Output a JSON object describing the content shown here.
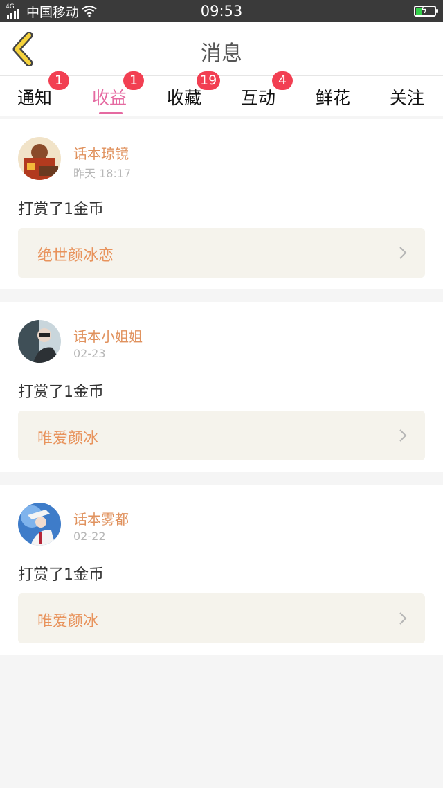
{
  "status_bar": {
    "network": "4G",
    "carrier": "中国移动",
    "time": "09:53"
  },
  "header": {
    "title": "消息",
    "back_icon": "chevron-left-icon"
  },
  "tabs": [
    {
      "label": "通知",
      "badge": "1"
    },
    {
      "label": "收益",
      "badge": "1",
      "active": true
    },
    {
      "label": "收藏",
      "badge": "19"
    },
    {
      "label": "互动",
      "badge": "4"
    },
    {
      "label": "鲜花",
      "badge": ""
    },
    {
      "label": "关注",
      "badge": ""
    }
  ],
  "messages": [
    {
      "user": "话本琼镜",
      "time": "昨天 18:17",
      "action": "打赏了1金币",
      "book": "绝世颜冰恋"
    },
    {
      "user": "话本小姐姐",
      "time": "02-23",
      "action": "打赏了1金币",
      "book": "唯爱颜冰"
    },
    {
      "user": "话本雾都",
      "time": "02-22",
      "action": "打赏了1金币",
      "book": "唯爱颜冰"
    }
  ],
  "colors": {
    "accent": "#e56aa1",
    "badge": "#f23f52",
    "username": "#e0925e",
    "book_title": "#e8935c",
    "back_icon": "#f5d23c"
  }
}
